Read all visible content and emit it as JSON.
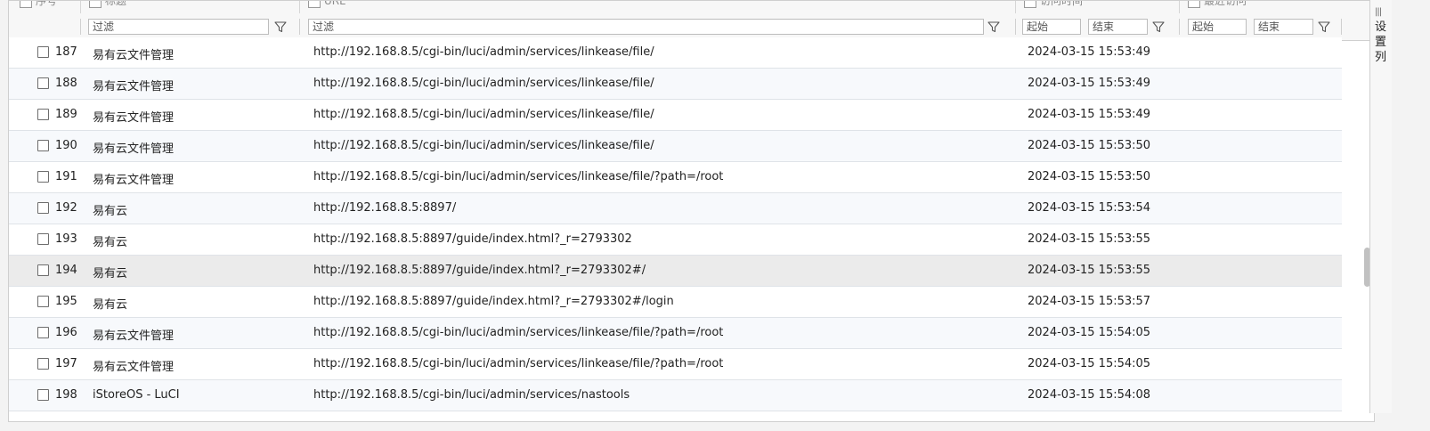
{
  "header": {
    "columns": [
      "序号",
      "标题",
      "URL",
      "访问时间",
      "最近访问"
    ]
  },
  "filters": {
    "title_placeholder": "过滤",
    "url_placeholder": "过滤",
    "visit_start": "起始",
    "visit_end": "结束",
    "last_start": "起始",
    "last_end": "结束"
  },
  "side_panel": {
    "label": "设置列"
  },
  "rows": [
    {
      "num": "187",
      "title": "易有云文件管理",
      "url": "http://192.168.8.5/cgi-bin/luci/admin/services/linkease/file/",
      "time": "2024-03-15 15:53:49"
    },
    {
      "num": "188",
      "title": "易有云文件管理",
      "url": "http://192.168.8.5/cgi-bin/luci/admin/services/linkease/file/",
      "time": "2024-03-15 15:53:49"
    },
    {
      "num": "189",
      "title": "易有云文件管理",
      "url": "http://192.168.8.5/cgi-bin/luci/admin/services/linkease/file/",
      "time": "2024-03-15 15:53:49"
    },
    {
      "num": "190",
      "title": "易有云文件管理",
      "url": "http://192.168.8.5/cgi-bin/luci/admin/services/linkease/file/",
      "time": "2024-03-15 15:53:50"
    },
    {
      "num": "191",
      "title": "易有云文件管理",
      "url": "http://192.168.8.5/cgi-bin/luci/admin/services/linkease/file/?path=/root",
      "time": "2024-03-15 15:53:50"
    },
    {
      "num": "192",
      "title": "易有云",
      "url": "http://192.168.8.5:8897/",
      "time": "2024-03-15 15:53:54"
    },
    {
      "num": "193",
      "title": "易有云",
      "url": "http://192.168.8.5:8897/guide/index.html?_r=2793302",
      "time": "2024-03-15 15:53:55"
    },
    {
      "num": "194",
      "title": "易有云",
      "url": "http://192.168.8.5:8897/guide/index.html?_r=2793302#/",
      "time": "2024-03-15 15:53:55"
    },
    {
      "num": "195",
      "title": "易有云",
      "url": "http://192.168.8.5:8897/guide/index.html?_r=2793302#/login",
      "time": "2024-03-15 15:53:57"
    },
    {
      "num": "196",
      "title": "易有云文件管理",
      "url": "http://192.168.8.5/cgi-bin/luci/admin/services/linkease/file/?path=/root",
      "time": "2024-03-15 15:54:05"
    },
    {
      "num": "197",
      "title": "易有云文件管理",
      "url": "http://192.168.8.5/cgi-bin/luci/admin/services/linkease/file/?path=/root",
      "time": "2024-03-15 15:54:05"
    },
    {
      "num": "198",
      "title": "iStoreOS - LuCI",
      "url": "http://192.168.8.5/cgi-bin/luci/admin/services/nastools",
      "time": "2024-03-15 15:54:08"
    }
  ]
}
